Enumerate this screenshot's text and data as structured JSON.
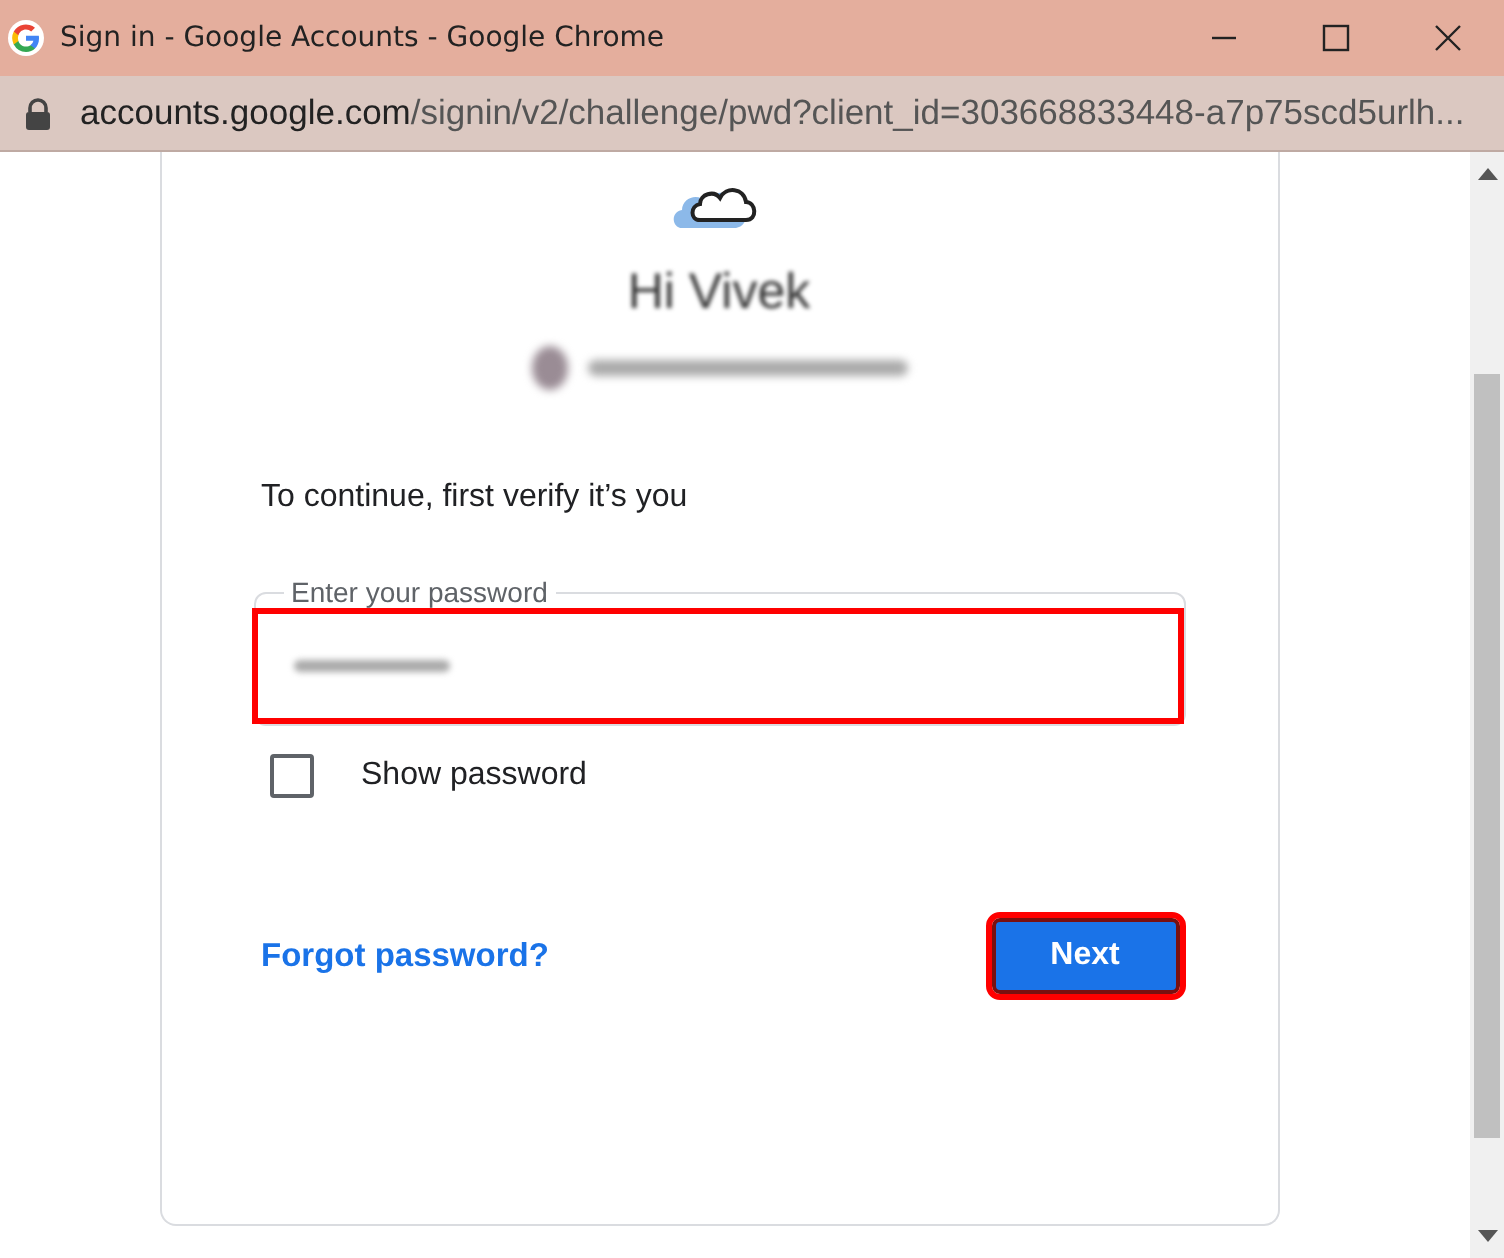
{
  "window": {
    "title": "Sign in - Google Accounts - Google Chrome"
  },
  "address_bar": {
    "domain": "accounts.google.com",
    "path": "/signin/v2/challenge/pwd?client_id=303668833448-a7p75scd5urlh..."
  },
  "card": {
    "greeting": "Hi Vivek",
    "prompt": "To continue, first verify it’s you",
    "password_field": {
      "label": "Enter your password",
      "highlighted": true
    },
    "show_password": {
      "label": "Show password",
      "checked": false
    },
    "forgot_link": "Forgot password?",
    "next_button": {
      "label": "Next",
      "highlighted": true
    }
  }
}
